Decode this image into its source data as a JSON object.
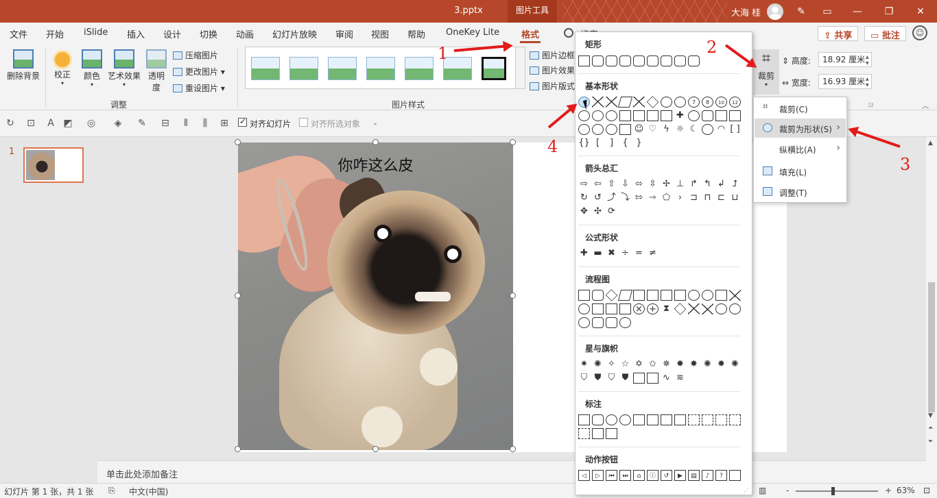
{
  "window": {
    "doc_title": "3.pptx",
    "context_tab": "图片工具",
    "user_name": "大海 桂"
  },
  "tabs": [
    "文件",
    "开始",
    "iSlide",
    "插入",
    "设计",
    "切换",
    "动画",
    "幻灯片放映",
    "审阅",
    "视图",
    "帮助",
    "OneKey Lite",
    "格式",
    "搜索"
  ],
  "active_tab": "格式",
  "share": {
    "share_label": "共享",
    "comment_label": "批注"
  },
  "ribbon": {
    "remove_bg": "删除背景",
    "correct": "校正",
    "color": "颜色",
    "art_effects": "艺术效果",
    "transparency_1": "透明",
    "transparency_2": "度",
    "compress": "压缩图片",
    "change": "更改图片",
    "reset": "重设图片",
    "group_adjust": "调整",
    "group_styles": "图片样式",
    "border": "图片边框",
    "effects": "图片效果",
    "layout": "图片版式",
    "crop": "裁剪",
    "height_label": "高度:",
    "height_value": "18.92 厘米",
    "width_label": "宽度:",
    "width_value": "16.93 厘米"
  },
  "qat": {
    "align_slide": "对齐幻灯片",
    "align_selected": "对齐所选对象",
    "align_slide_checked": true,
    "align_selected_checked": false
  },
  "slides": {
    "current_number": "1"
  },
  "slide": {
    "caption": "你咋这么皮"
  },
  "notes": {
    "placeholder": "单击此处添加备注"
  },
  "status": {
    "slide_info": "幻灯片 第 1 张，共 1 张",
    "language": "中文(中国)",
    "zoom": "63%",
    "zoom_minus": "-",
    "zoom_plus": "+"
  },
  "shape_panel": {
    "sections": [
      "矩形",
      "基本形状",
      "箭头总汇",
      "公式形状",
      "流程图",
      "星与旗帜",
      "标注",
      "动作按钮"
    ]
  },
  "crop_menu": {
    "items": [
      "裁剪(C)",
      "裁剪为形状(S)",
      "纵横比(A)",
      "填充(L)",
      "调整(T)"
    ],
    "highlighted": "裁剪为形状(S)"
  },
  "annotations": [
    "1",
    "2",
    "3",
    "4"
  ],
  "colors": {
    "accent": "#b7472a",
    "annotation": "#e21b1b",
    "highlight": "#dcdcdc"
  }
}
